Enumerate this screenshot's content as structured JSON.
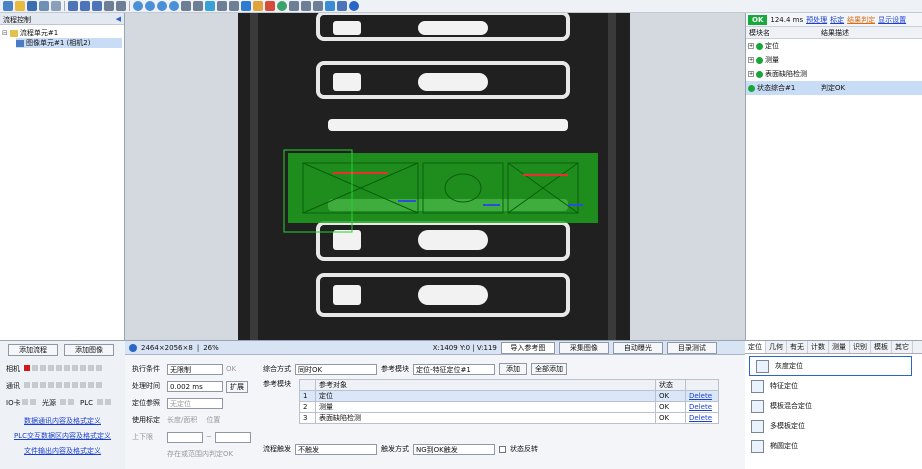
{
  "left_panel": {
    "title": "流程控制",
    "tree": [
      {
        "label": "流程单元#1"
      },
      {
        "label": "图像单元#1 (相机2)"
      }
    ]
  },
  "status": {
    "resolution": "2464×2056×8",
    "zoom": "26%",
    "coord": "X:1409 Y:0 | V:119"
  },
  "image_buttons": {
    "import": "导入参考图",
    "capture": "采集图像",
    "auto_exposure": "自动曝光",
    "test": "目录测试"
  },
  "right_panel": {
    "ok": "OK",
    "time": "124.4 ms",
    "links": [
      "预处理",
      "标定",
      "结果判定",
      "显示设置"
    ],
    "headers": [
      "模块名",
      "结果描述"
    ],
    "modules": [
      {
        "name": "定位",
        "result": ""
      },
      {
        "name": "测量",
        "result": ""
      },
      {
        "name": "表面缺陷检测",
        "result": ""
      },
      {
        "name": "状态综合#1",
        "result": "判定OK"
      }
    ]
  },
  "bottom_left": {
    "add_flow": "添加流程",
    "add_image": "添加图像",
    "rows": [
      {
        "label": "相机"
      },
      {
        "label": "通讯"
      },
      {
        "label": "IO卡",
        "light": "光源",
        "plc": "PLC"
      }
    ],
    "links": [
      "数据通讯内容及格式定义",
      "PLC交互数据区内容及格式定义",
      "文件输出内容及格式定义"
    ]
  },
  "bottom_mid": {
    "exec_label": "执行条件",
    "exec_value": "无限制",
    "ok_label": "OK",
    "time_label": "处理时间",
    "time_value": "0.002 ms",
    "expand": "扩展",
    "calib_label": "使用标定",
    "calib_value": "无定位",
    "ref_label": "定位参照",
    "len_label": "长度/面积",
    "pos_label": "位置",
    "range_label": "上下限",
    "tilde": "~",
    "judge_label": "存在或范围内判定OK",
    "combine_label": "综合方式",
    "combine_value": "同时OK",
    "ref_module_label": "参考模块",
    "ref_module_value": "定位-特征定位#1",
    "add": "添加",
    "add_all": "全部添加",
    "ref_modules_label": "参考模块",
    "table_headers": [
      "",
      "参考对象",
      "状态",
      ""
    ],
    "table_rows": [
      {
        "i": "1",
        "name": "定位",
        "state": "OK",
        "del": "Delete"
      },
      {
        "i": "2",
        "name": "测量",
        "state": "OK",
        "del": "Delete"
      },
      {
        "i": "3",
        "name": "表面缺陷检测",
        "state": "OK",
        "del": "Delete"
      }
    ],
    "trigger_label": "流程触发",
    "trigger_value": "不触发",
    "trigger_mode_label": "触发方式",
    "trigger_mode_value": "NG到OK触发",
    "invert_label": "状态反转"
  },
  "bottom_right": {
    "tabs": [
      "定位",
      "几何",
      "有无",
      "计数",
      "测量",
      "识别",
      "模板",
      "其它"
    ],
    "tools": [
      "灰度定位",
      "特征定位",
      "模板混合定位",
      "多模板定位",
      "椭圆定位"
    ]
  }
}
